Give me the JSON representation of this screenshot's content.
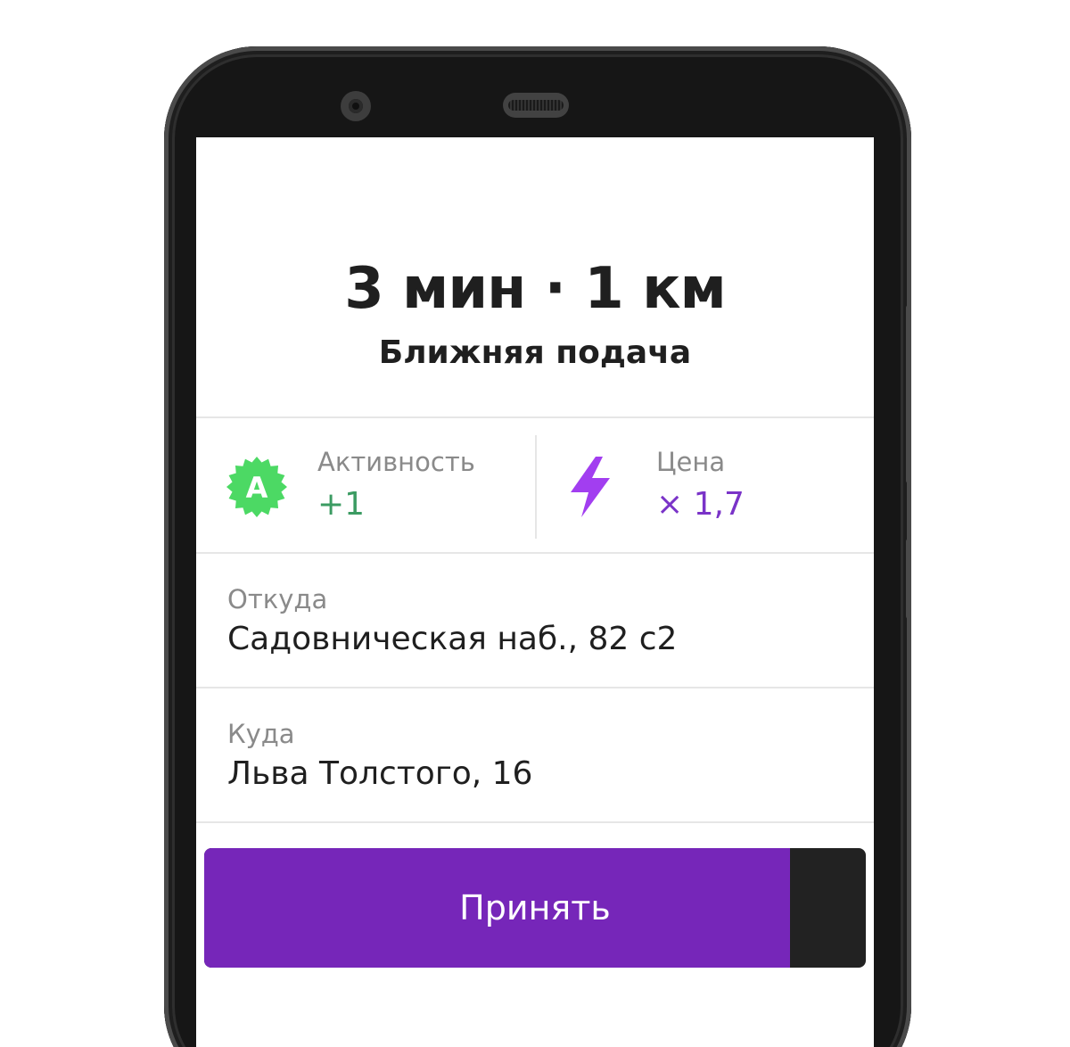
{
  "order": {
    "title": "3 мин · 1 км",
    "subtitle": "Ближняя подача"
  },
  "metrics": {
    "activity": {
      "label": "Активность",
      "value": "+1",
      "badge_letter": "A",
      "icon": "activity-badge-icon",
      "color": "#3b9b62",
      "badge_color": "#4cd964"
    },
    "price": {
      "label": "Цена",
      "value": "× 1,7",
      "icon": "lightning-icon",
      "color": "#7a33c8"
    }
  },
  "route": {
    "from_label": "Откуда",
    "from_value": "Садовническая наб., 82 с2",
    "to_label": "Куда",
    "to_value": "Льва Толстого, 16"
  },
  "accept_button": {
    "label": "Принять",
    "color": "#7626b9",
    "countdown_progress": 0.885
  }
}
